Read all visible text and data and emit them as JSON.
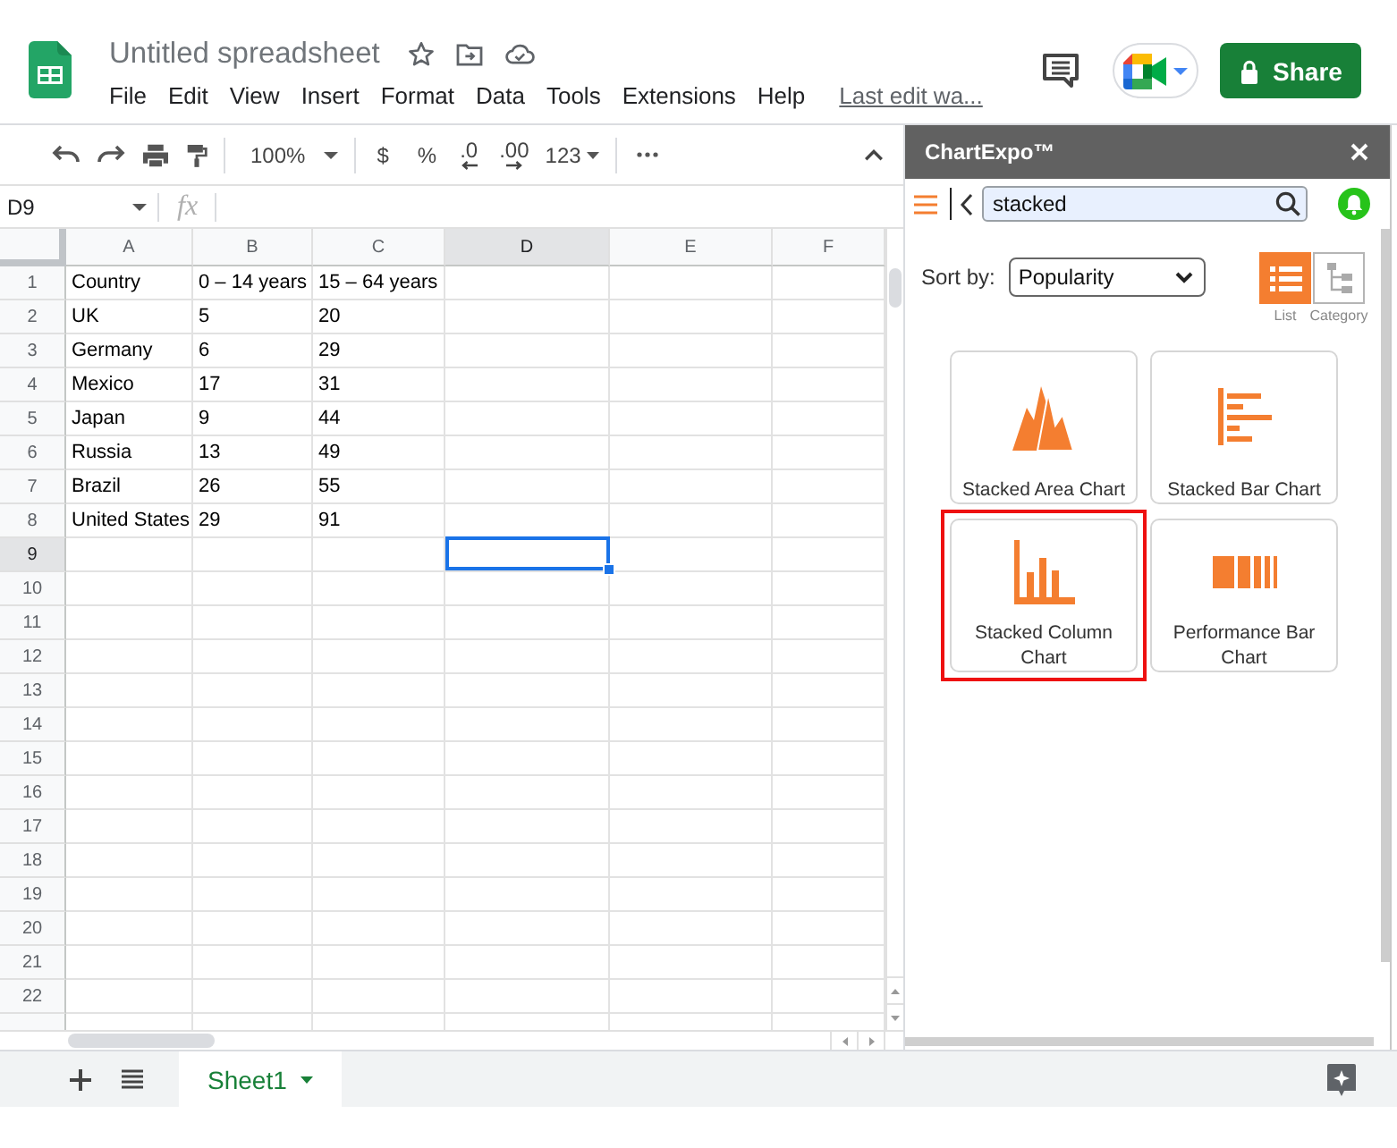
{
  "header": {
    "title": "Untitled spreadsheet",
    "menu": [
      "File",
      "Edit",
      "View",
      "Insert",
      "Format",
      "Data",
      "Tools",
      "Extensions",
      "Help"
    ],
    "last_edit": "Last edit wa...",
    "share": "Share"
  },
  "toolbar": {
    "zoom": "100%",
    "currency": "$",
    "percent": "%",
    "decrease_decimals": ".0",
    "increase_decimals": ".00",
    "number_format": "123"
  },
  "formula_bar": {
    "name_box": "D9",
    "fx": "fx"
  },
  "grid": {
    "columns": [
      {
        "label": "A",
        "selected": false
      },
      {
        "label": "B",
        "selected": false
      },
      {
        "label": "C",
        "selected": false
      },
      {
        "label": "D",
        "selected": true
      },
      {
        "label": "E",
        "selected": false
      },
      {
        "label": "F",
        "selected": false
      }
    ],
    "rows": [
      {
        "label": "1",
        "selected": false,
        "cells": [
          "Country",
          "0 – 14 years",
          "15 – 64 years"
        ]
      },
      {
        "label": "2",
        "selected": false,
        "cells": [
          "UK",
          "5",
          "20"
        ]
      },
      {
        "label": "3",
        "selected": false,
        "cells": [
          "Germany",
          "6",
          "29"
        ]
      },
      {
        "label": "4",
        "selected": false,
        "cells": [
          "Mexico",
          "17",
          "31"
        ]
      },
      {
        "label": "5",
        "selected": false,
        "cells": [
          "Japan",
          "9",
          "44"
        ]
      },
      {
        "label": "6",
        "selected": false,
        "cells": [
          "Russia",
          "13",
          "49"
        ]
      },
      {
        "label": "7",
        "selected": false,
        "cells": [
          "Brazil",
          "26",
          "55"
        ]
      },
      {
        "label": "8",
        "selected": false,
        "cells": [
          "United States",
          "29",
          "91"
        ]
      },
      {
        "label": "9",
        "selected": true
      },
      {
        "label": "10",
        "selected": false
      },
      {
        "label": "11",
        "selected": false
      },
      {
        "label": "12",
        "selected": false
      },
      {
        "label": "13",
        "selected": false
      },
      {
        "label": "14",
        "selected": false
      },
      {
        "label": "15",
        "selected": false
      },
      {
        "label": "16",
        "selected": false
      },
      {
        "label": "17",
        "selected": false
      },
      {
        "label": "18",
        "selected": false
      },
      {
        "label": "19",
        "selected": false
      },
      {
        "label": "20",
        "selected": false
      },
      {
        "label": "21",
        "selected": false
      },
      {
        "label": "22",
        "selected": false
      }
    ]
  },
  "side_panel": {
    "title": "ChartExpo™",
    "search": {
      "value": "stacked"
    },
    "sort": {
      "label": "Sort by:",
      "value": "Popularity"
    },
    "views": [
      {
        "kind": "list",
        "label": "List",
        "selected": true
      },
      {
        "kind": "category",
        "label": "Category",
        "selected": false
      }
    ],
    "charts": [
      {
        "kind": "area",
        "name": "Stacked Area Chart",
        "highlighted": false
      },
      {
        "kind": "bar",
        "name": "Stacked Bar Chart",
        "highlighted": false
      },
      {
        "kind": "column",
        "name": "Stacked Column Chart",
        "highlighted": true
      },
      {
        "kind": "performance",
        "name": "Performance Bar Chart",
        "highlighted": false
      }
    ]
  },
  "sheets": [
    {
      "name": "Sheet1",
      "selected": true
    }
  ]
}
